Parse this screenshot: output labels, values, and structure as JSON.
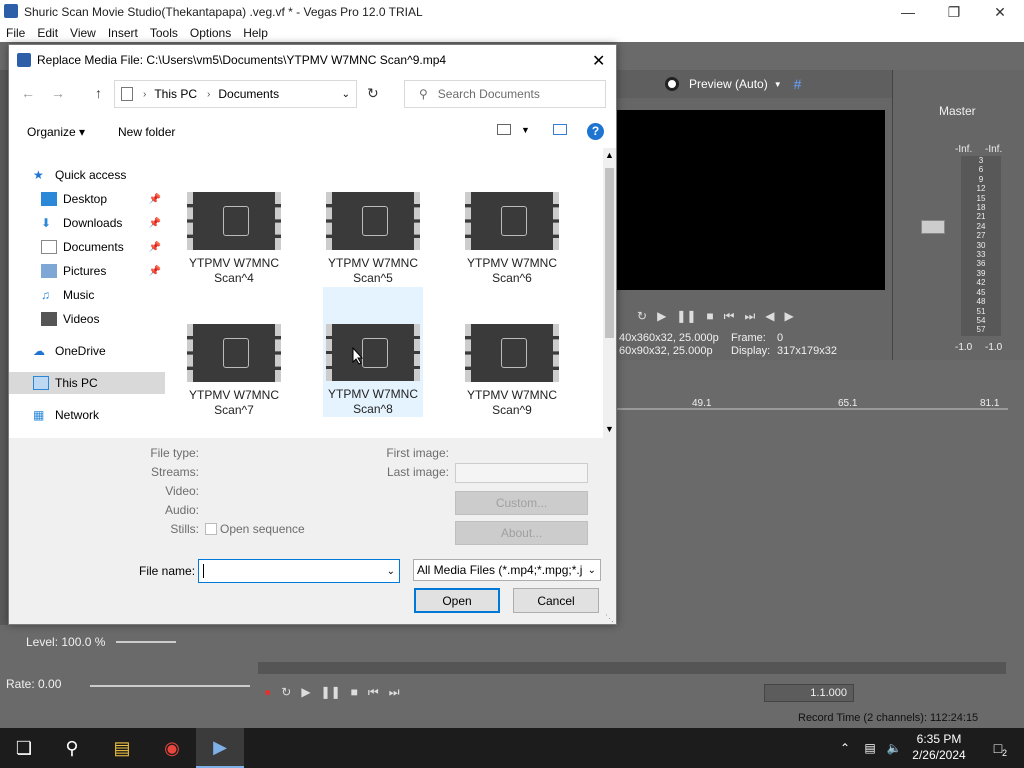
{
  "app": {
    "title": "Shuric Scan Movie Studio(Thekantapapa) .veg.vf * - Vegas Pro 12.0 TRIAL",
    "menu": [
      "File",
      "Edit",
      "View",
      "Insert",
      "Tools",
      "Options",
      "Help"
    ]
  },
  "preview": {
    "mode": "Preview (Auto)",
    "info1": "40x360x32, 25.000p",
    "info2": "60x90x32, 25.000p",
    "frame_label": "Frame:",
    "frame_value": "0",
    "display_label": "Display:",
    "display_value": "317x179x32"
  },
  "mixer": {
    "title": "Master",
    "left_level": "-Inf.",
    "right_level": "-Inf.",
    "bottom_left": "-1.0",
    "bottom_right": "-1.0",
    "scale": [
      "3",
      "6",
      "9",
      "12",
      "15",
      "18",
      "21",
      "24",
      "27",
      "30",
      "33",
      "36",
      "39",
      "42",
      "45",
      "48",
      "51",
      "54",
      "57"
    ]
  },
  "timeline": {
    "markers": [
      "49.1",
      "65.1",
      "81.1"
    ],
    "time_readout": "1.1.000",
    "record_time": "Record Time (2 channels): 112:24:15"
  },
  "lower_left": {
    "level": "Level: 100.0 %",
    "rate": "Rate: 0.00"
  },
  "dialog": {
    "title": "Replace Media File: C:\\Users\\vm5\\Documents\\YTPMV W7MNC Scan^9.mp4",
    "breadcrumb": [
      "This PC",
      "Documents"
    ],
    "search_placeholder": "Search Documents",
    "organize": "Organize",
    "new_folder": "New folder",
    "nav": [
      {
        "label": "Quick access"
      },
      {
        "label": "Desktop"
      },
      {
        "label": "Downloads"
      },
      {
        "label": "Documents"
      },
      {
        "label": "Pictures"
      },
      {
        "label": "Music"
      },
      {
        "label": "Videos"
      },
      {
        "label": "OneDrive"
      },
      {
        "label": "This PC"
      },
      {
        "label": "Network"
      }
    ],
    "files": [
      {
        "line1": "YTPMV W7MNC",
        "line2": "Scan^4"
      },
      {
        "line1": "YTPMV W7MNC",
        "line2": "Scan^5"
      },
      {
        "line1": "YTPMV W7MNC",
        "line2": "Scan^6"
      },
      {
        "line1": "YTPMV W7MNC",
        "line2": "Scan^7"
      },
      {
        "line1": "YTPMV W7MNC",
        "line2": "Scan^8"
      },
      {
        "line1": "YTPMV W7MNC",
        "line2": "Scan^9"
      }
    ],
    "info_labels": {
      "file_type": "File type:",
      "streams": "Streams:",
      "video": "Video:",
      "audio": "Audio:",
      "stills": "Stills:",
      "open_sequence": "Open sequence",
      "first_image": "First image:",
      "last_image": "Last image:"
    },
    "custom_btn": "Custom...",
    "about_btn": "About...",
    "file_name_label": "File name:",
    "file_name_value": "",
    "filter": "All Media Files (*.mp4;*.mpg;*.j",
    "open_btn": "Open",
    "cancel_btn": "Cancel"
  },
  "taskbar": {
    "time": "6:35 PM",
    "date": "2/26/2024",
    "notifications": "2"
  }
}
